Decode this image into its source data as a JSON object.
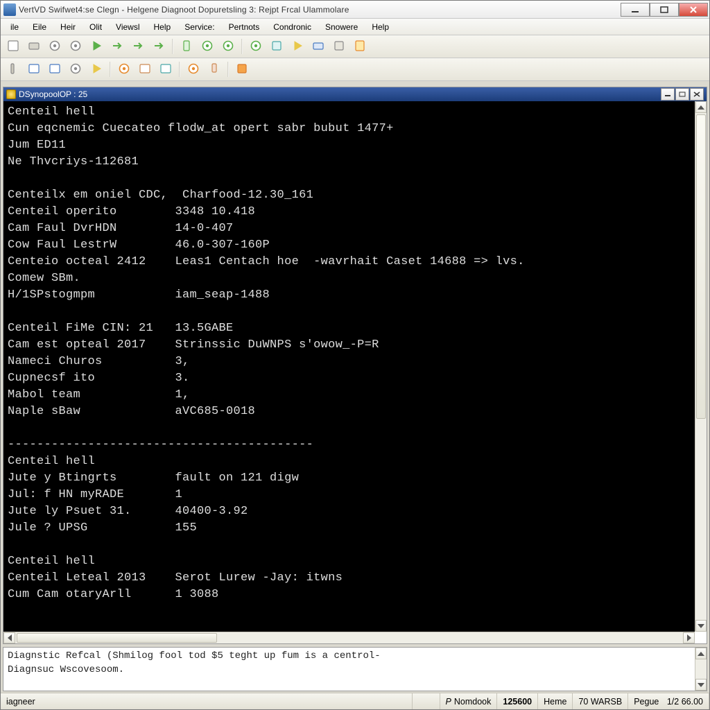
{
  "window": {
    "title": "VertVD Swifwet4:se Clegn - Helgene Diagnoot Dopuretsling 3: Rejpt Frcal Ulammolare"
  },
  "menu": [
    "ile",
    "Eile",
    "Heir",
    "Olit",
    "Viewsl",
    "Help",
    "Service:",
    "Pertnots",
    "Condronic",
    "Snowere",
    "Help"
  ],
  "doc": {
    "title": "DSynopoolOP : 25",
    "lines": [
      "Centeil hell",
      "Cun eqcnemic Cuecateo flodw_at opert sabr bubut 1477+",
      "Jum ED11",
      "Ne Thvcriys-112681",
      "",
      "Centeilx em oniel CDC,  Charfood-12.30_161",
      "Centeil operito        3348 10.418",
      "Cam Faul DvrHDN        14-0-407",
      "Cow Faul LestrW        46.0-307-160P",
      "Centeio octeal 2412    Leas1 Centach hoe  -wavrhait Caset 14688 => lvs.",
      "Comew SBm.",
      "H/1SPstogmpm           iam_seap-1488",
      "",
      "Centeil FiMe CIN: 21   13.5GABE",
      "Cam est opteal 2017    Strinssic DuWNPS s'owow_-P=R",
      "Nameci Churos          3,",
      "Cupnecsf ito           3.",
      "Mabol team             1,",
      "Naple sBaw             aVC685-0018",
      "",
      "------------------------------------------",
      "Centeil hell",
      "Jute y Btingrts        fault on 121 digw",
      "Jul: f HN myRADE       1",
      "Jute ly Psuet 31.      40400-3.92",
      "Jule ? UPSG            155",
      "",
      "Centeil hell",
      "Centeil Leteal 2013    Serot Lurew -Jay: itwns",
      "Cum Cam otaryArll      1 3088"
    ]
  },
  "output": {
    "lines": [
      "Diagnstic Refcal (Shmilog fool tod $5 teght up fum is a centrol-",
      "Diagnsuc Wscovesoom."
    ]
  },
  "status": {
    "left": "iagneer",
    "mode_icon": "P",
    "mode": "Nomdook",
    "col": "125600",
    "heme": "Heme",
    "fmt": "70 WARSB",
    "page_label": "Pegue",
    "page": "1/2 66.00"
  },
  "toolbar1_icons": [
    "new-file",
    "disk-stack",
    "history",
    "target",
    "play",
    "stepover",
    "stepin",
    "stepout",
    "sep",
    "phone",
    "record",
    "reload",
    "sep",
    "gear-green",
    "badge",
    "bolt",
    "credit",
    "wrench",
    "page-yellow"
  ],
  "toolbar2_icons": [
    "handle",
    "window",
    "window2",
    "zoom",
    "pencil",
    "sep",
    "key",
    "photo",
    "window3",
    "sep",
    "key2",
    "mic",
    "sep",
    "stop-orange"
  ]
}
